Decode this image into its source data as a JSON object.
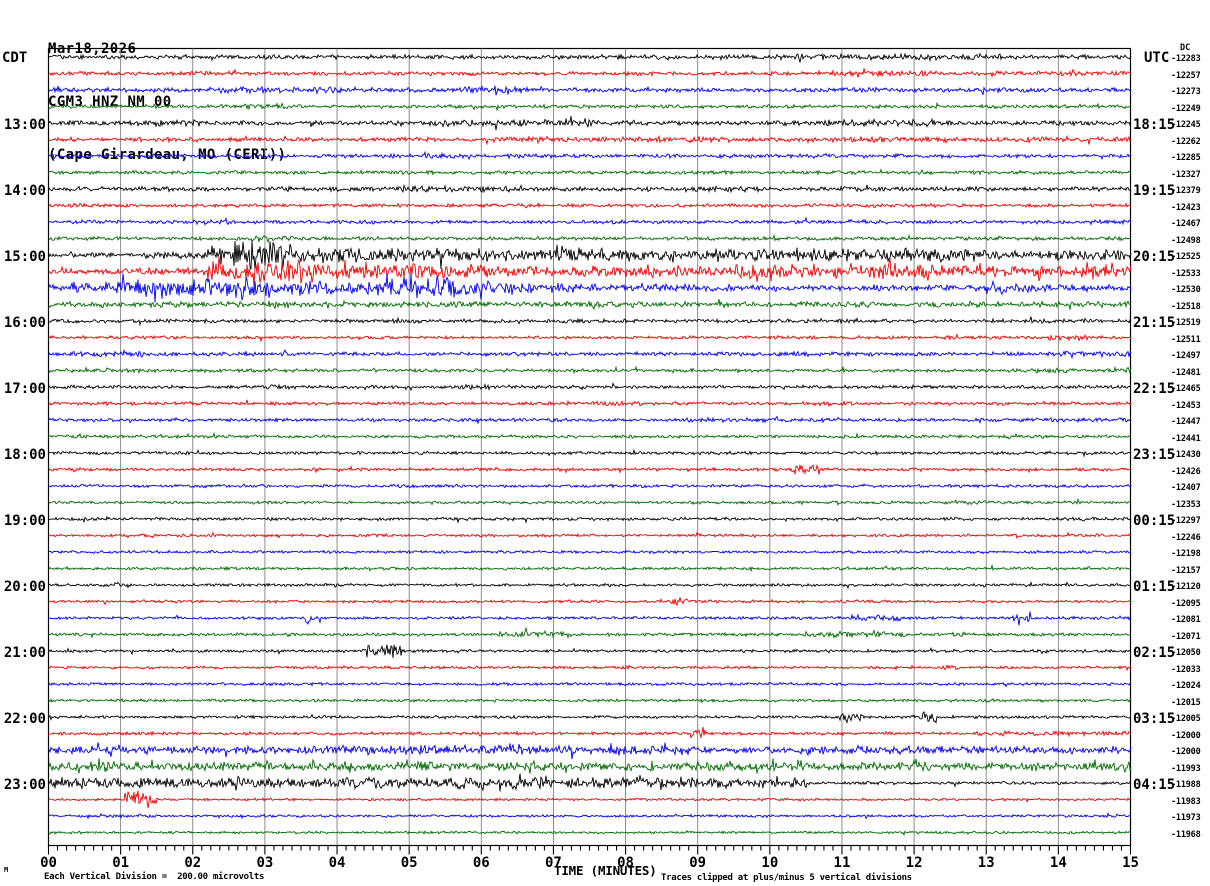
{
  "header": {
    "date": "Mar18,2026",
    "station": "CGM3 HNZ NM 00",
    "location": "(Cape Girardeau, MO (CERI))"
  },
  "axis": {
    "left_tz": "CDT",
    "right_tz": "UTC",
    "dc_heading": "DC",
    "x_title": "TIME (MINUTES)",
    "x_tick_labels": [
      "00",
      "01",
      "02",
      "03",
      "04",
      "05",
      "06",
      "07",
      "08",
      "09",
      "10",
      "11",
      "12",
      "13",
      "14",
      "15"
    ],
    "footer_left": "Each Vertical Division =  200.00 microvolts",
    "footer_right": "Traces clipped at plus/minus 5 vertical divisions",
    "corner_mark": "M"
  },
  "palette": {
    "black": "#000000",
    "red": "#f00000",
    "blue": "#0000f0",
    "green": "#006a00",
    "grid": "#808080",
    "frame": "#000000"
  },
  "chart_data": {
    "type": "line",
    "title": "Helicorder seismogram CGM3 HNZ NM 00 (Cape Girardeau, MO (CERI)) Mar18,2026",
    "x_label": "TIME (MINUTES)",
    "x_range_minutes": [
      0,
      15
    ],
    "minutes_per_row": 15,
    "rows_per_hour": 4,
    "color_cycle": [
      "black",
      "red",
      "blue",
      "green"
    ],
    "microvolts_per_division": 200.0,
    "clip_divisions": 5,
    "grid": "vertical gridlines every minute",
    "legend_position": "none",
    "rows": [
      {
        "color": "black",
        "dc": "-12283",
        "base": 1.7,
        "events": [
          [
            9.8,
            13.2,
            2.4
          ]
        ]
      },
      {
        "color": "red",
        "dc": "-12257",
        "base": 1.5,
        "events": [
          [
            10.6,
            12.3,
            2.1
          ],
          [
            13.6,
            15,
            1.9
          ]
        ]
      },
      {
        "color": "blue",
        "dc": "-12273",
        "base": 1.7,
        "events": [
          [
            2.2,
            4.6,
            2.3
          ],
          [
            5.7,
            6.7,
            3.2
          ]
        ]
      },
      {
        "color": "green",
        "dc": "-12249",
        "base": 1.4,
        "events": [
          [
            2.7,
            3.3,
            2.6
          ]
        ]
      },
      {
        "color": "black",
        "cdt": "13:00",
        "utc": "18:15",
        "dc": "-12245",
        "base": 1.8,
        "events": [
          [
            1.3,
            2.1,
            2.5
          ],
          [
            5.2,
            7.6,
            2.7
          ],
          [
            10.2,
            12.3,
            2.7
          ]
        ]
      },
      {
        "color": "red",
        "dc": "-12262",
        "base": 1.6,
        "events": [
          [
            6,
            9.5,
            2.2
          ],
          [
            10.5,
            12.5,
            2.2
          ],
          [
            13.4,
            15,
            2.0
          ]
        ]
      },
      {
        "color": "blue",
        "dc": "-12285",
        "base": 1.5,
        "events": [
          [
            5.2,
            5.8,
            2.2
          ]
        ]
      },
      {
        "color": "green",
        "dc": "-12327",
        "base": 1.4,
        "events": []
      },
      {
        "color": "black",
        "cdt": "14:00",
        "utc": "19:15",
        "dc": "-12379",
        "base": 1.7,
        "events": [
          [
            4.8,
            6.6,
            2.4
          ],
          [
            8.8,
            10,
            2.2
          ]
        ]
      },
      {
        "color": "red",
        "dc": "-12423",
        "base": 1.4,
        "events": [
          [
            0.2,
            1.2,
            1.8
          ]
        ]
      },
      {
        "color": "blue",
        "dc": "-12467",
        "base": 1.4,
        "events": [
          [
            2.0,
            2.5,
            2.2
          ]
        ]
      },
      {
        "color": "green",
        "dc": "-12498",
        "base": 1.4,
        "events": [
          [
            2.8,
            3.4,
            2.4
          ]
        ]
      },
      {
        "color": "black",
        "cdt": "15:00",
        "utc": "20:15",
        "dc": "-12525",
        "base": 1.7,
        "events": [
          [
            1.3,
            2.2,
            2.8
          ],
          [
            2.2,
            2.5,
            5.5
          ],
          [
            2.5,
            3.4,
            10.5
          ],
          [
            3.4,
            5.0,
            6
          ],
          [
            5.0,
            8.0,
            4.8
          ],
          [
            8.0,
            9.0,
            4.2
          ],
          [
            9.0,
            12.5,
            5.2
          ],
          [
            12.5,
            15,
            3.8
          ]
        ]
      },
      {
        "color": "red",
        "dc": "-12533",
        "base": 1.9,
        "events": [
          [
            1.0,
            2.2,
            2.8
          ],
          [
            2.2,
            3.5,
            8.5
          ],
          [
            3.5,
            5.0,
            5.5
          ],
          [
            5.0,
            6.0,
            6.5
          ],
          [
            6.0,
            8.0,
            4.8
          ],
          [
            8.0,
            9.5,
            3.8
          ],
          [
            9.5,
            11.0,
            5.5
          ],
          [
            11.0,
            12.2,
            6.5
          ],
          [
            12.2,
            13.5,
            4.8
          ],
          [
            13.5,
            15,
            4.8
          ]
        ]
      },
      {
        "color": "blue",
        "dc": "-12530",
        "base": 2.4,
        "events": [
          [
            0.25,
            1.0,
            4.5
          ],
          [
            1.0,
            2.3,
            7.5
          ],
          [
            2.3,
            3.5,
            6.5
          ],
          [
            3.5,
            4.5,
            4.8
          ],
          [
            4.5,
            5.7,
            7.5
          ],
          [
            5.7,
            6.6,
            5.5
          ],
          [
            6.6,
            7.4,
            3.8
          ],
          [
            7.4,
            9.0,
            2.8
          ],
          [
            9.0,
            13.0,
            1.9
          ],
          [
            13.0,
            13.7,
            3.6
          ],
          [
            13.7,
            15,
            1.9
          ]
        ]
      },
      {
        "color": "green",
        "dc": "-12518",
        "base": 2.1,
        "events": [
          [
            3.0,
            3.4,
            2.8
          ]
        ]
      },
      {
        "color": "black",
        "cdt": "16:00",
        "utc": "21:15",
        "dc": "-12519",
        "base": 1.4,
        "events": [
          [
            4.6,
            5.2,
            2.0
          ],
          [
            13.5,
            14.5,
            1.8
          ]
        ]
      },
      {
        "color": "red",
        "dc": "-12511",
        "base": 1.3,
        "events": [
          [
            13.8,
            14.4,
            2.2
          ]
        ]
      },
      {
        "color": "blue",
        "dc": "-12497",
        "base": 1.5,
        "events": [
          [
            0,
            1.6,
            2.2
          ],
          [
            10,
            11.5,
            1.8
          ],
          [
            14,
            15,
            2.0
          ]
        ]
      },
      {
        "color": "green",
        "dc": "-12481",
        "base": 1.3,
        "events": [
          [
            0.8,
            1.3,
            2.0
          ],
          [
            8.5,
            9.3,
            1.7
          ],
          [
            13.3,
            14.2,
            1.8
          ],
          [
            14.6,
            15,
            2.2
          ]
        ]
      },
      {
        "color": "black",
        "cdt": "17:00",
        "utc": "22:15",
        "dc": "-12465",
        "base": 1.3,
        "events": [
          [
            3.0,
            3.6,
            1.9
          ],
          [
            5.5,
            6.1,
            2.0
          ]
        ]
      },
      {
        "color": "red",
        "dc": "-12453",
        "base": 1.3,
        "events": [
          [
            7.5,
            8.0,
            1.8
          ],
          [
            10.5,
            11.2,
            1.7
          ]
        ]
      },
      {
        "color": "blue",
        "dc": "-12447",
        "base": 1.3,
        "events": [
          [
            8.8,
            10.2,
            1.7
          ],
          [
            13.5,
            15,
            1.7
          ]
        ]
      },
      {
        "color": "green",
        "dc": "-12441",
        "base": 1.2,
        "events": []
      },
      {
        "color": "black",
        "cdt": "18:00",
        "utc": "23:15",
        "dc": "-12430",
        "base": 1.2,
        "events": []
      },
      {
        "color": "red",
        "dc": "-12426",
        "base": 1.2,
        "events": [
          [
            10.3,
            10.7,
            4.2
          ]
        ]
      },
      {
        "color": "blue",
        "dc": "-12407",
        "base": 1.2,
        "events": []
      },
      {
        "color": "green",
        "dc": "-12353",
        "base": 1.1,
        "events": [
          [
            12.5,
            13.0,
            1.7
          ]
        ]
      },
      {
        "color": "black",
        "cdt": "19:00",
        "utc": "00:15",
        "dc": "-12297",
        "base": 1.2,
        "events": [
          [
            13.9,
            15,
            1.5
          ]
        ]
      },
      {
        "color": "red",
        "dc": "-12246",
        "base": 1.1,
        "events": []
      },
      {
        "color": "blue",
        "dc": "-12198",
        "base": 1.1,
        "events": []
      },
      {
        "color": "green",
        "dc": "-12157",
        "base": 1.1,
        "events": []
      },
      {
        "color": "black",
        "cdt": "20:00",
        "utc": "01:15",
        "dc": "-12120",
        "base": 1.1,
        "events": [
          [
            0.9,
            1.15,
            2.0
          ]
        ]
      },
      {
        "color": "red",
        "dc": "-12095",
        "base": 1.1,
        "events": [
          [
            8.6,
            8.85,
            3.2
          ]
        ]
      },
      {
        "color": "blue",
        "dc": "-12081",
        "base": 1.1,
        "events": [
          [
            3.55,
            3.8,
            3.2
          ],
          [
            11.1,
            11.8,
            2.6
          ],
          [
            13.35,
            13.6,
            3.8
          ]
        ]
      },
      {
        "color": "green",
        "dc": "-12071",
        "base": 1.2,
        "events": [
          [
            6.2,
            7.3,
            2.4
          ],
          [
            10.4,
            11.9,
            2.4
          ],
          [
            12.4,
            12.7,
            1.9
          ]
        ]
      },
      {
        "color": "black",
        "cdt": "21:00",
        "utc": "02:15",
        "dc": "-12050",
        "base": 1.1,
        "events": [
          [
            4.35,
            4.9,
            4.2
          ]
        ]
      },
      {
        "color": "red",
        "dc": "-12033",
        "base": 1.1,
        "events": [
          [
            7.95,
            8.15,
            1.9
          ],
          [
            12.4,
            12.6,
            1.9
          ]
        ]
      },
      {
        "color": "blue",
        "dc": "-12024",
        "base": 1.1,
        "events": []
      },
      {
        "color": "green",
        "dc": "-12015",
        "base": 1.1,
        "events": []
      },
      {
        "color": "black",
        "cdt": "22:00",
        "utc": "03:15",
        "dc": "-12005",
        "base": 1.1,
        "events": [
          [
            10.95,
            11.3,
            3.8
          ],
          [
            12.05,
            12.3,
            4.2
          ]
        ]
      },
      {
        "color": "red",
        "dc": "-12000",
        "base": 1.2,
        "events": [
          [
            8.9,
            9.1,
            4.5
          ],
          [
            12.7,
            15,
            1.7
          ]
        ]
      },
      {
        "color": "blue",
        "dc": "-12000",
        "base": 2.9,
        "events": [
          [
            3.5,
            9.0,
            3.6
          ]
        ]
      },
      {
        "color": "green",
        "dc": "-11993",
        "base": 3.4,
        "events": []
      },
      {
        "color": "black",
        "cdt": "23:00",
        "utc": "04:15",
        "dc": "-11988",
        "base": 1.2,
        "events": [
          [
            0,
            6,
            4.0
          ],
          [
            6,
            9,
            4.4
          ],
          [
            9,
            10.5,
            3.6
          ]
        ]
      },
      {
        "color": "red",
        "dc": "-11983",
        "base": 1.0,
        "events": [
          [
            1.05,
            1.5,
            8.5
          ]
        ]
      },
      {
        "color": "blue",
        "dc": "-11973",
        "base": 1.0,
        "events": [
          [
            0.5,
            1.5,
            1.5
          ]
        ]
      },
      {
        "color": "green",
        "dc": "-11968",
        "base": 0.95,
        "events": []
      }
    ]
  }
}
